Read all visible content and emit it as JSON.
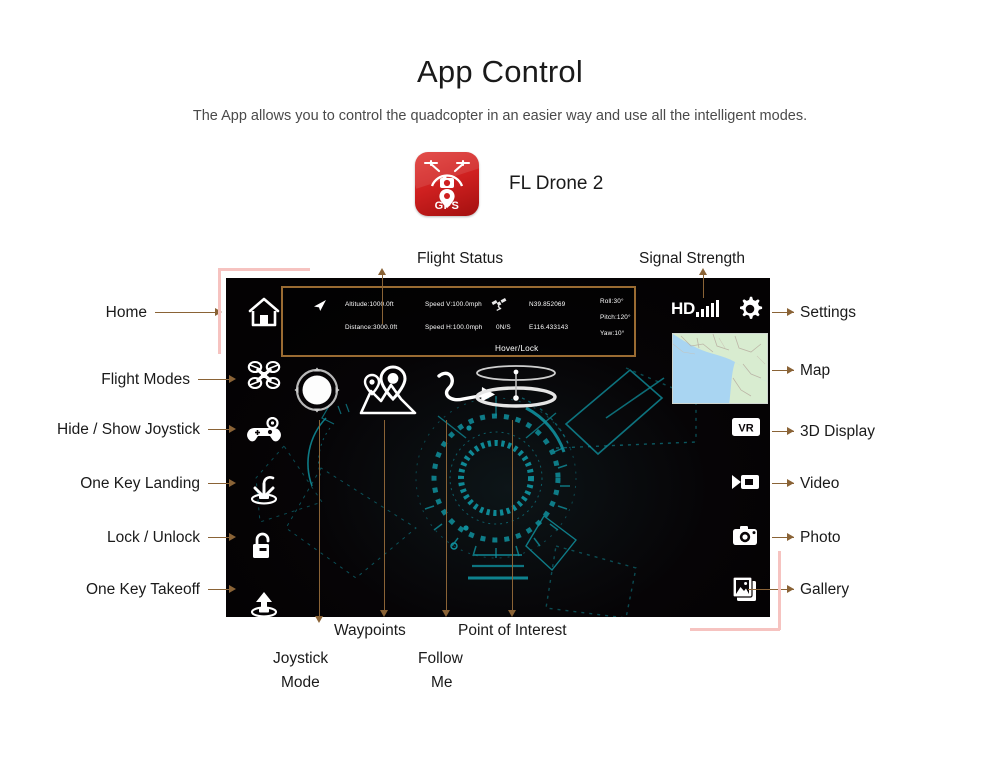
{
  "header": {
    "title": "App Control",
    "subtitle": "The App allows you to control the quadcopter in an easier way and use all the intelligent modes."
  },
  "app": {
    "icon_name": "drone-camera-gps-icon",
    "icon_badge_text": "GPS",
    "name": "FL Drone 2",
    "icon_color": "#cf2020"
  },
  "screen": {
    "background_color": "#0a0608",
    "hud_accent_color": "#0e8a96",
    "telemetry": {
      "border_color": "#9a6b32",
      "altitude": "Altitude:1000.0ft",
      "distance": "Distance:3000.0ft",
      "speed_v": "Speed V:100.0mph",
      "speed_h": "Speed H:100.0mph",
      "satellites": "0N/S",
      "latitude": "N39.852069",
      "longitude": "E116.433143",
      "roll": "Roll:30°",
      "pitch": "Pitch:120°",
      "yaw": "Yaw:10°",
      "status": "Hover/Lock"
    },
    "signal": {
      "quality_text": "HD",
      "bars": 5,
      "bars_filled": 5
    },
    "left_rail": [
      {
        "id": "home",
        "icon": "home-icon"
      },
      {
        "id": "flight-modes",
        "icon": "quadcopter-icon"
      },
      {
        "id": "joystick-toggle",
        "icon": "gamepad-icon"
      },
      {
        "id": "one-key-landing",
        "icon": "drone-landing-icon"
      },
      {
        "id": "lock-unlock",
        "icon": "padlock-open-icon"
      },
      {
        "id": "one-key-takeoff",
        "icon": "drone-takeoff-icon"
      }
    ],
    "right_rail": [
      {
        "id": "settings",
        "icon": "gear-icon"
      },
      {
        "id": "map",
        "icon": "map-thumbnail"
      },
      {
        "id": "3d-display",
        "icon": "vr-icon"
      },
      {
        "id": "video",
        "icon": "video-camera-icon"
      },
      {
        "id": "photo",
        "icon": "photo-camera-icon"
      },
      {
        "id": "gallery",
        "icon": "gallery-icon"
      }
    ],
    "center_widgets": [
      {
        "id": "joystick",
        "icon": "joystick-ring-icon"
      },
      {
        "id": "waypoints",
        "icon": "map-pins-icon"
      },
      {
        "id": "follow-me",
        "icon": "curved-arrow-icon"
      },
      {
        "id": "point-of-interest",
        "icon": "orbit-rings-icon"
      }
    ]
  },
  "callouts": {
    "top": [
      {
        "id": "flight-status",
        "label": "Flight Status"
      },
      {
        "id": "signal-strength",
        "label": "Signal Strength"
      }
    ],
    "left": [
      {
        "id": "home",
        "label": "Home"
      },
      {
        "id": "flight-modes",
        "label": "Flight Modes"
      },
      {
        "id": "joystick-toggle",
        "label": "Hide / Show Joystick"
      },
      {
        "id": "one-key-landing",
        "label": "One Key Landing"
      },
      {
        "id": "lock-unlock",
        "label": "Lock / Unlock"
      },
      {
        "id": "one-key-takeoff",
        "label": "One Key Takeoff"
      }
    ],
    "right": [
      {
        "id": "settings",
        "label": "Settings"
      },
      {
        "id": "map",
        "label": "Map"
      },
      {
        "id": "3d-display",
        "label": "3D Display"
      },
      {
        "id": "video",
        "label": "Video"
      },
      {
        "id": "photo",
        "label": "Photo"
      },
      {
        "id": "gallery",
        "label": "Gallery"
      }
    ],
    "bottom": [
      {
        "id": "joystick-mode",
        "label_line1": "Joystick",
        "label_line2": "Mode"
      },
      {
        "id": "waypoints",
        "label_line1": "Waypoints",
        "label_line2": ""
      },
      {
        "id": "follow-me",
        "label_line1": "Follow",
        "label_line2": "Me"
      },
      {
        "id": "point-of-interest",
        "label_line1": "Point of Interest",
        "label_line2": ""
      }
    ],
    "connector_color": "#8a6336",
    "bracket_color": "#f6c3c0"
  }
}
